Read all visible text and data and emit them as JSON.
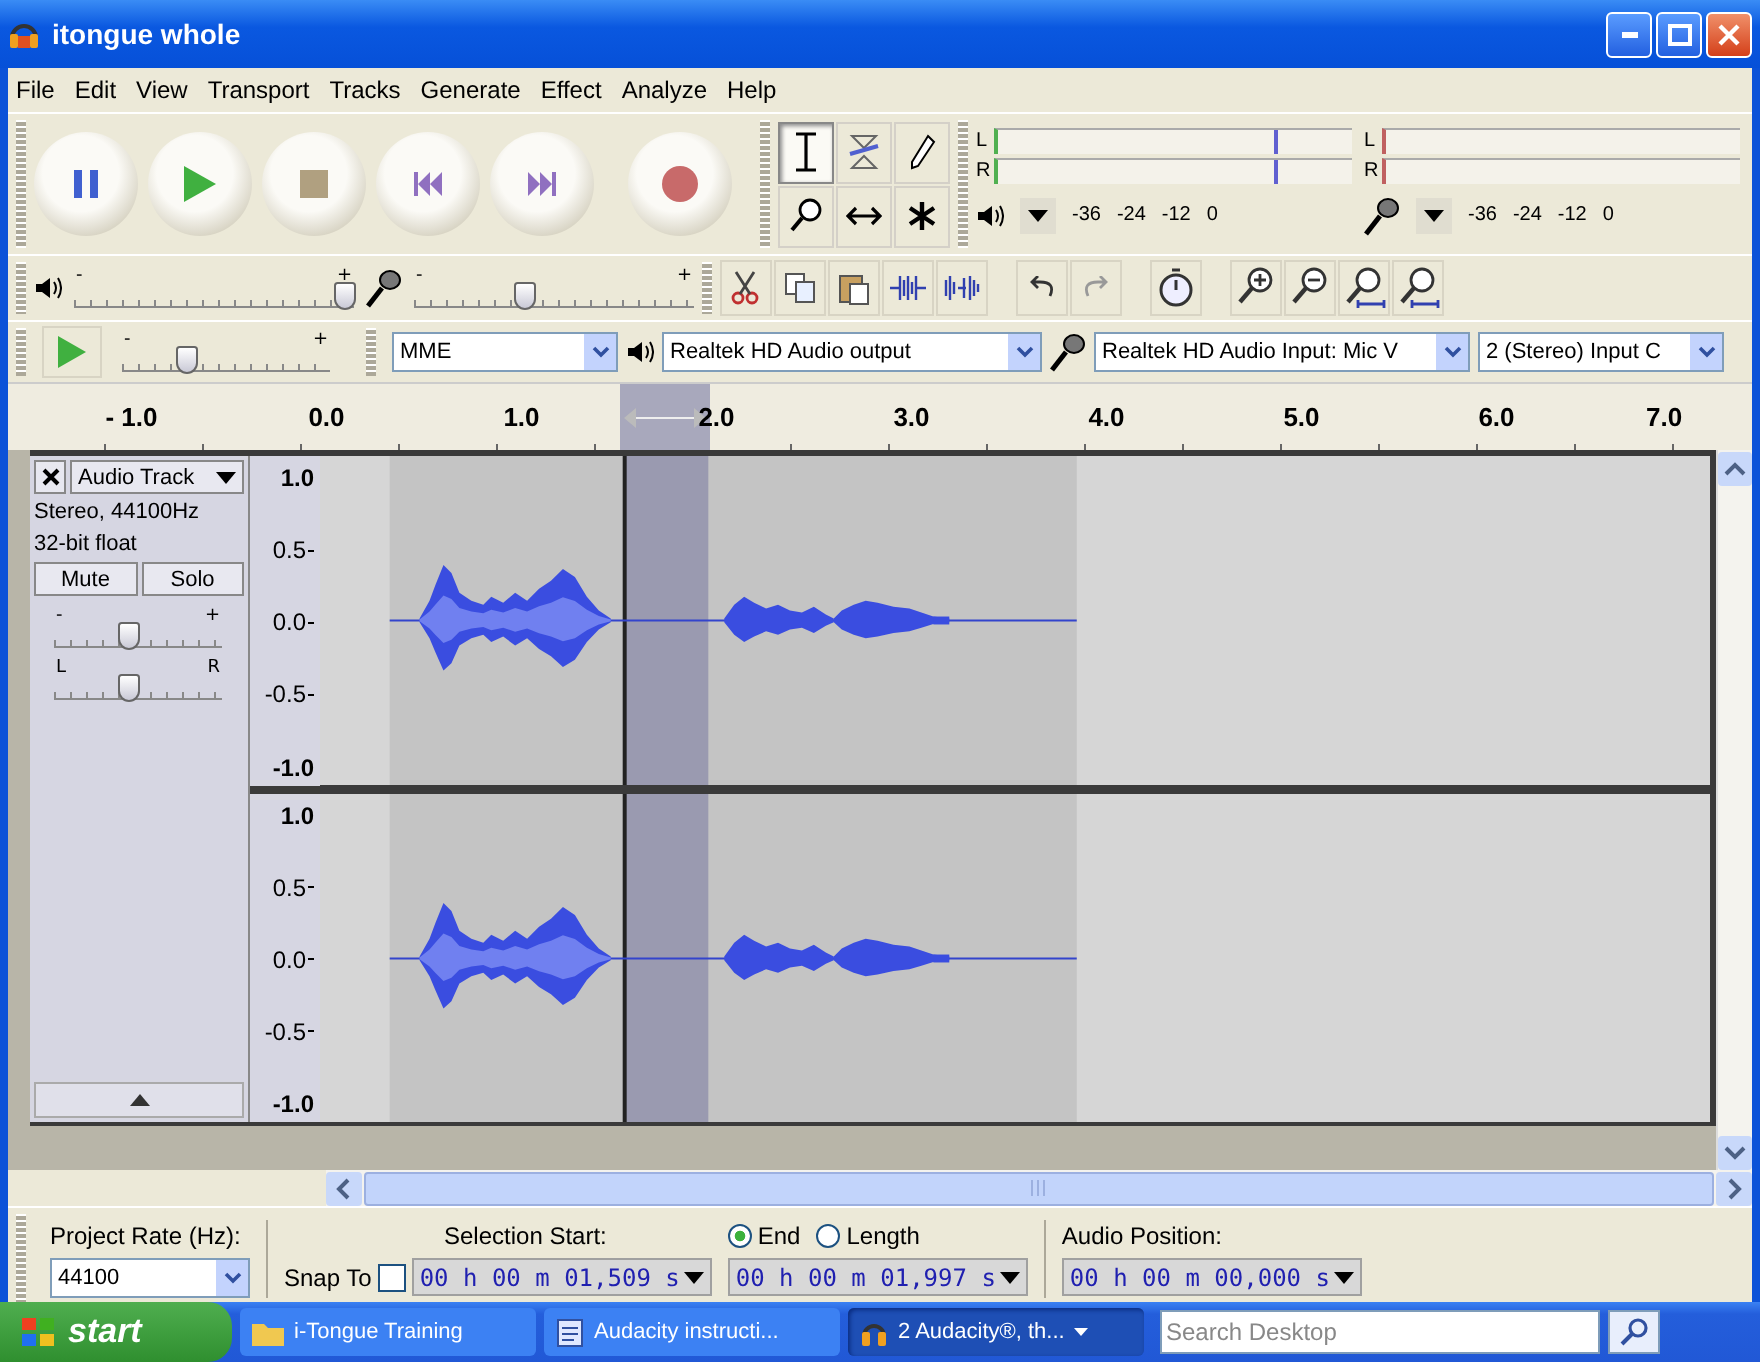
{
  "window": {
    "title": "itongue whole"
  },
  "menu": [
    "File",
    "Edit",
    "View",
    "Transport",
    "Tracks",
    "Generate",
    "Effect",
    "Analyze",
    "Help"
  ],
  "tools": [
    {
      "selected": true
    },
    {
      "selected": false
    },
    {
      "selected": false
    },
    {
      "selected": false
    },
    {
      "selected": false
    },
    {
      "selected": false
    }
  ],
  "playback_meter": {
    "channels": [
      "L",
      "R"
    ],
    "scale": [
      "-36",
      "-24",
      "-12",
      "0"
    ]
  },
  "record_meter": {
    "channels": [
      "L",
      "R"
    ],
    "scale": [
      "-36",
      "-24",
      "-12",
      "0"
    ]
  },
  "playback_volume": {
    "min_label": "-",
    "max_label": "+",
    "level": 0.97
  },
  "record_volume": {
    "min_label": "-",
    "max_label": "+",
    "level": 0.4
  },
  "play_at_speed": {
    "min_label": "-",
    "max_label": "+",
    "level": 0.32
  },
  "devices": {
    "host": "MME",
    "output": "Realtek HD Audio output",
    "input": "Realtek HD Audio Input: Mic V",
    "channels": "2 (Stereo) Input C"
  },
  "ruler": [
    "- 1.0",
    "0.0",
    "1.0",
    "2.0",
    "3.0",
    "4.0",
    "5.0",
    "6.0",
    "7.0"
  ],
  "track": {
    "name": "Audio Track",
    "info": [
      "Stereo, 44100Hz",
      "32-bit float"
    ],
    "mute": {
      "label": "Mute",
      "on": false
    },
    "solo": {
      "label": "Solo",
      "on": false
    },
    "gain": {
      "min_label": "-",
      "max_label": "+",
      "level": 0.45
    },
    "pan": {
      "min_label": "L",
      "max_label": "R",
      "level": 0.45
    },
    "channels": [
      {
        "scale": [
          "1.0",
          "0.5",
          "0.0",
          "-0.5",
          "-1.0"
        ]
      },
      {
        "scale": [
          "1.0",
          "0.5",
          "0.0",
          "-0.5",
          "-1.0"
        ]
      }
    ]
  },
  "selection_bar": {
    "project_rate": {
      "label": "Project Rate (Hz):",
      "value": "44100"
    },
    "snap": {
      "label": "Snap To",
      "checked": false
    },
    "selection_start": {
      "label": "Selection Start:",
      "value": "00 h 00 m 01,509 s"
    },
    "end_mode": [
      {
        "label": "End",
        "selected": true
      },
      {
        "label": "Length",
        "selected": false
      }
    ],
    "selection_end": {
      "value": "00 h 00 m 01,997 s"
    },
    "audio_position": {
      "label": "Audio Position:",
      "value": "00 h 00 m 00,000 s"
    }
  },
  "taskbar": {
    "start": "start",
    "tasks": [
      {
        "label": "i-Tongue Training",
        "selected": false
      },
      {
        "label": "Audacity instructi...",
        "selected": false
      },
      {
        "label": "2 Audacity®, th...",
        "selected": true
      }
    ],
    "search": {
      "placeholder": "Search Desktop"
    }
  }
}
